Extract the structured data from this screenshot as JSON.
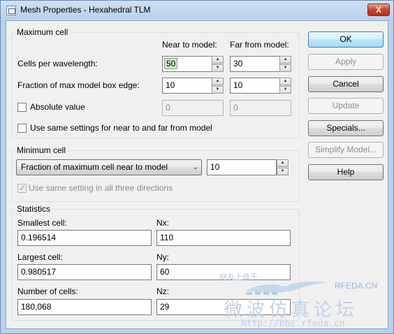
{
  "window": {
    "title": "Mesh Properties - Hexahedral TLM",
    "close_glyph": "X"
  },
  "maximum_cell": {
    "group_label": "Maximum cell",
    "col_near": "Near to model:",
    "col_far": "Far from model:",
    "cells_per_wavelength": {
      "label": "Cells per wavelength:",
      "near": "50",
      "far": "30"
    },
    "fraction_edge": {
      "label": "Fraction of max model box edge:",
      "near": "10",
      "far": "10"
    },
    "absolute_value": {
      "label": "Absolute value",
      "checked": false,
      "near": "0",
      "far": "0"
    },
    "same_settings": {
      "label": "Use same settings for near to and far from model",
      "checked": false
    }
  },
  "minimum_cell": {
    "group_label": "Minimum cell",
    "dropdown_value": "Fraction of maximum cell near to model",
    "value": "10",
    "same_setting": {
      "label": "Use same setting in all three directions",
      "checked": true
    }
  },
  "statistics": {
    "group_label": "Statistics",
    "smallest_label": "Smallest cell:",
    "smallest_value": "0.196514",
    "largest_label": "Largest cell:",
    "largest_value": "0.980517",
    "number_label": "Number of cells:",
    "number_value": "180,068",
    "nx_label": "Nx:",
    "nx_value": "110",
    "ny_label": "Ny:",
    "ny_value": "60",
    "nz_label": "Nz:",
    "nz_value": "29"
  },
  "buttons": {
    "ok": "OK",
    "apply": "Apply",
    "cancel": "Cancel",
    "update": "Update",
    "specials": "Specials...",
    "simplify": "Simplify Model...",
    "help": "Help"
  },
  "watermark": {
    "brand": "RFEDA.CN",
    "chinese": "微波仿真论坛",
    "url": "http://bbs.rfeda.cn",
    "tagline": "网友上传于"
  }
}
